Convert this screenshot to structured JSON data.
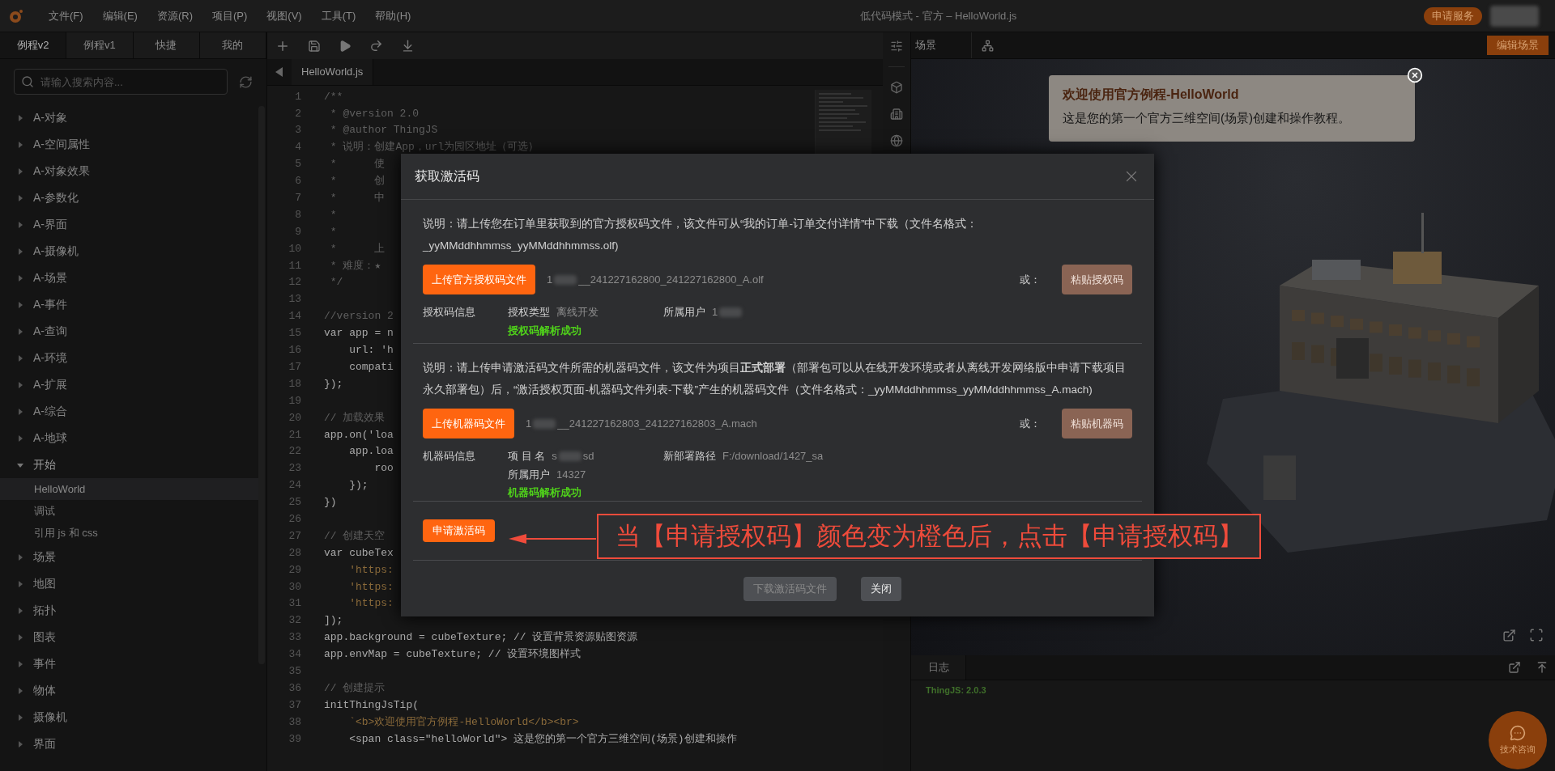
{
  "top_bar": {
    "menu": [
      "文件(F)",
      "编辑(E)",
      "资源(R)",
      "项目(P)",
      "视图(V)",
      "工具(T)",
      "帮助(H)"
    ],
    "title": "低代码模式 - 官方 – HelloWorld.js",
    "service_button": "申请服务"
  },
  "sidebar": {
    "tabs": [
      {
        "label": "例程v2",
        "selected": true
      },
      {
        "label": "例程v1",
        "selected": false
      },
      {
        "label": "快捷",
        "selected": false
      },
      {
        "label": "我的",
        "selected": false
      }
    ],
    "search": {
      "placeholder": "请输入搜索内容..."
    },
    "tree": [
      {
        "label": "A-对象",
        "expanded": false,
        "selected": false
      },
      {
        "label": "A-空间属性",
        "expanded": false,
        "selected": false
      },
      {
        "label": "A-对象效果",
        "expanded": false,
        "selected": false
      },
      {
        "label": "A-参数化",
        "expanded": false,
        "selected": false
      },
      {
        "label": "A-界面",
        "expanded": false,
        "selected": false
      },
      {
        "label": "A-摄像机",
        "expanded": false,
        "selected": false
      },
      {
        "label": "A-场景",
        "expanded": false,
        "selected": false
      },
      {
        "label": "A-事件",
        "expanded": false,
        "selected": false
      },
      {
        "label": "A-查询",
        "expanded": false,
        "selected": false
      },
      {
        "label": "A-环境",
        "expanded": false,
        "selected": false
      },
      {
        "label": "A-扩展",
        "expanded": false,
        "selected": false
      },
      {
        "label": "A-综合",
        "expanded": false,
        "selected": false
      },
      {
        "label": "A-地球",
        "expanded": false,
        "selected": false
      },
      {
        "label": "开始",
        "expanded": true,
        "selected": false,
        "children": [
          {
            "label": "HelloWorld",
            "selected": true
          },
          {
            "label": "调试",
            "selected": false
          },
          {
            "label": "引用 js 和 css",
            "selected": false
          }
        ]
      },
      {
        "label": "场景",
        "expanded": false,
        "selected": false
      },
      {
        "label": "地图",
        "expanded": false,
        "selected": false
      },
      {
        "label": "拓扑",
        "expanded": false,
        "selected": false
      },
      {
        "label": "图表",
        "expanded": false,
        "selected": false
      },
      {
        "label": "事件",
        "expanded": false,
        "selected": false
      },
      {
        "label": "物体",
        "expanded": false,
        "selected": false
      },
      {
        "label": "摄像机",
        "expanded": false,
        "selected": false
      },
      {
        "label": "界面",
        "expanded": false,
        "selected": false
      }
    ]
  },
  "editor": {
    "tab": "HelloWorld.js",
    "lines": [
      {
        "number": "1",
        "text": "/**",
        "kind": "comment"
      },
      {
        "number": "2",
        "text": " * @version 2.0",
        "kind": "comment"
      },
      {
        "number": "3",
        "text": " * @author ThingJS",
        "kind": "comment"
      },
      {
        "number": "4",
        "text": " * 说明：创建App，url为园区地址（可选）",
        "kind": "comment"
      },
      {
        "number": "5",
        "text": " *      使",
        "kind": "comment"
      },
      {
        "number": "6",
        "text": " *      创",
        "kind": "comment"
      },
      {
        "number": "7",
        "text": " *      中",
        "kind": "comment"
      },
      {
        "number": "8",
        "text": " *",
        "kind": "comment"
      },
      {
        "number": "9",
        "text": " *",
        "kind": "comment"
      },
      {
        "number": "10",
        "text": " *      上",
        "kind": "comment"
      },
      {
        "number": "11",
        "text": " * 难度：★",
        "kind": "comment"
      },
      {
        "number": "12",
        "text": " */",
        "kind": "comment"
      },
      {
        "number": "13"
      },
      {
        "number": "14",
        "text": "//version 2",
        "kind": "comment"
      },
      {
        "number": "15",
        "text": "var app = n",
        "kind": "code"
      },
      {
        "number": "16",
        "text": "    url: 'h",
        "kind": "code"
      },
      {
        "number": "17",
        "text": "    compati",
        "kind": "code"
      },
      {
        "number": "18",
        "text": "});",
        "kind": "code"
      },
      {
        "number": "19"
      },
      {
        "number": "20",
        "text": "// 加载效果",
        "kind": "comment"
      },
      {
        "number": "21",
        "text": "app.on('loa",
        "kind": "code"
      },
      {
        "number": "22",
        "text": "    app.loa",
        "kind": "code"
      },
      {
        "number": "23",
        "text": "        roo",
        "kind": "code"
      },
      {
        "number": "24",
        "text": "    });",
        "kind": "code"
      },
      {
        "number": "25",
        "text": "})",
        "kind": "code"
      },
      {
        "number": "26"
      },
      {
        "number": "27",
        "text": "// 创建天空",
        "kind": "comment"
      },
      {
        "number": "28",
        "text": "var cubeTex",
        "kind": "code"
      },
      {
        "number": "29",
        "text": "    'https:",
        "kind": "string"
      },
      {
        "number": "30",
        "text": "    'https:",
        "kind": "string"
      },
      {
        "number": "31",
        "text": "    'https:",
        "kind": "string"
      },
      {
        "number": "32",
        "text": "]);",
        "kind": "code"
      },
      {
        "number": "33",
        "text": "app.background = cubeTexture; // 设置背景资源贴图资源",
        "kind": "code"
      },
      {
        "number": "34",
        "text": "app.envMap = cubeTexture; // 设置环境图样式",
        "kind": "code"
      },
      {
        "number": "35"
      },
      {
        "number": "36",
        "text": "// 创建提示",
        "kind": "comment"
      },
      {
        "number": "37",
        "text": "initThingJsTip(",
        "kind": "code"
      },
      {
        "number": "38",
        "text": "    `<b>欢迎使用官方例程-HelloWorld</b><br>",
        "kind": "string"
      },
      {
        "number": "39",
        "text": "    <span class=\"helloWorld\"> 这是您的第一个官方三维空间(场景)创建和操作",
        "kind": "code"
      }
    ]
  },
  "scene_panel": {
    "tab": "场景",
    "edit_button": "编辑场景",
    "tip": {
      "title": "欢迎使用官方例程-HelloWorld",
      "text": "这是您的第一个官方三维空间(场景)创建和操作教程。"
    },
    "log": {
      "tab": "日志",
      "lines": [
        "ThingJS: 2.0.3"
      ]
    },
    "help_button": "技术咨询"
  },
  "dialog": {
    "title": "获取激活码",
    "sections": [
      {
        "description": "说明：请上传您在订单里获取到的官方授权码文件，该文件可从“我的订单-订单交付详情”中下载（文件名格式：_yyMMddhhmmss_yyMMddhhmmss.olf)",
        "upload_button": "上传官方授权码文件",
        "file_start": "1",
        "file_end": "__241227162800_241227162800_A.olf",
        "or_label": "或：",
        "paste_button": "粘贴授权码",
        "info_label": "授权码信息",
        "fields": [
          {
            "label": "授权类型",
            "value": "离线开发"
          },
          {
            "label": "所属用户",
            "value_start": "1"
          }
        ],
        "status": "授权码解析成功"
      },
      {
        "description": "说明：请上传申请激活码文件所需的机器码文件，该文件为项目**正式部署**（部署包可以从在线开发环境或者从离线开发网络版中申请下载项目永久部署包）后，“激活授权页面-机器码文件列表-下载”产生的机器码文件（文件名格式：_yyMMddhhmmss_yyMMddhhmmss_A.mach)",
        "upload_button": "上传机器码文件",
        "file_start": "1",
        "file_end": "__241227162803_241227162803_A.mach",
        "or_label": "或：",
        "paste_button": "粘贴机器码",
        "info_label": "机器码信息",
        "fields": [
          {
            "label": "项 目 名",
            "value_start": "s",
            "value": "sd"
          },
          {
            "label": "新部署路径",
            "value": "F:/download/1427_sa"
          },
          {
            "label": "所属用户",
            "value": "14327"
          }
        ],
        "status": "机器码解析成功"
      }
    ],
    "apply_button": "申请激活码",
    "footer_buttons": [
      {
        "label": "下载激活码文件",
        "disabled": true
      },
      {
        "label": "关闭",
        "disabled": false
      }
    ]
  },
  "annotation": {
    "text": "当【申请授权码】颜色变为橙色后，点击【申请授权码】"
  }
}
